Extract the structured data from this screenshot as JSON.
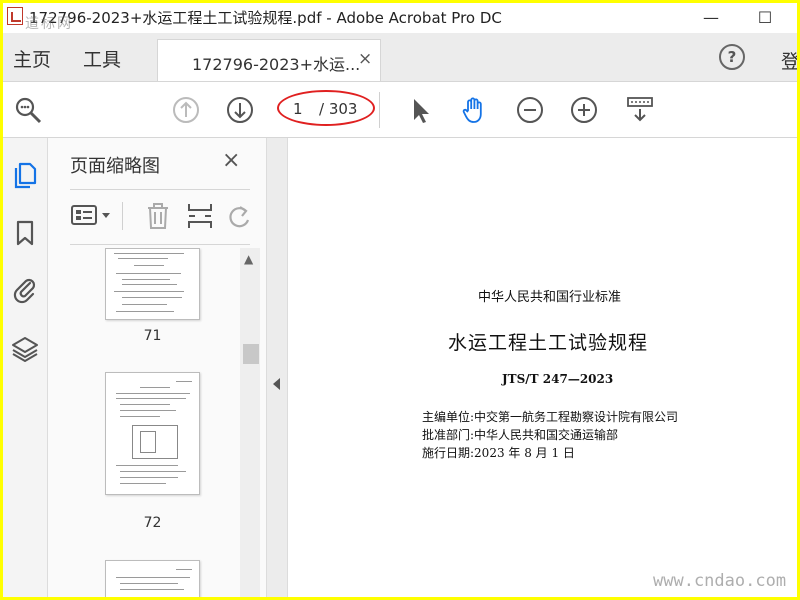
{
  "window": {
    "title": "172796-2023+水运工程土工试验规程.pdf - Adobe Acrobat Pro DC",
    "watermark_top": "道标网",
    "minimize_glyph": "—",
    "maximize_glyph": "☐"
  },
  "tabs": {
    "home": "主页",
    "tools": "工具",
    "document": "172796-2023+水运...",
    "close_glyph": "×",
    "help_glyph": "?",
    "login": "登"
  },
  "toolbar": {
    "current_page": "1",
    "total_pages": "/ 303",
    "icons": [
      "zoom-icon",
      "page-up-icon",
      "page-down-icon",
      "select-cursor-icon",
      "hand-icon",
      "zoom-out-icon",
      "zoom-in-icon",
      "keyboard-icon"
    ],
    "accent": "#1473e6",
    "highlight": "#e02020"
  },
  "left_rail": {
    "icons": [
      "page-thumbnails-icon",
      "bookmark-icon",
      "attachment-icon",
      "layers-icon"
    ],
    "active": "page-thumbnails-icon"
  },
  "thumbnail_panel": {
    "title": "页面缩略图",
    "close_glyph": "×",
    "tools": [
      "options-menu-icon",
      "delete-icon",
      "insert-page-icon",
      "rotate-icon"
    ],
    "pages": [
      {
        "label": "71"
      },
      {
        "label": "72"
      }
    ]
  },
  "document": {
    "header": "中华人民共和国行业标准",
    "title": "水运工程土工试验规程",
    "code": "JTS/T 247—2023",
    "editor": "主编单位:中交第一航务工程勘察设计院有限公司",
    "approver": "批准部门:中华人民共和国交通运输部",
    "effective_date": "施行日期:2023 年 8 月 1 日"
  },
  "watermark_bottom": "www.cndao.com"
}
